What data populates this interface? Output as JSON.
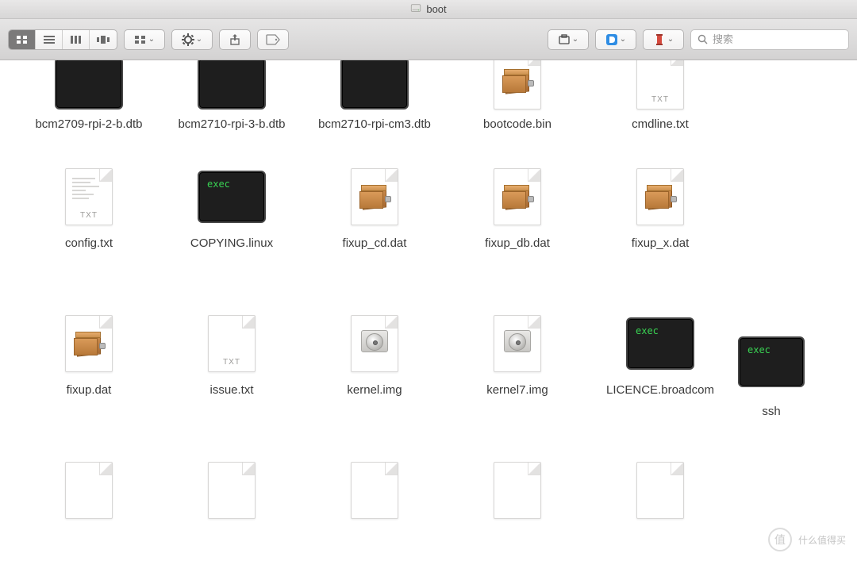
{
  "window": {
    "title": "boot"
  },
  "toolbar": {
    "search_placeholder": "搜索"
  },
  "icons": {
    "exec_label": "exec"
  },
  "files": {
    "row1": [
      {
        "name": "bcm2709-rpi-2-b.dtb",
        "kind": "exec-plain"
      },
      {
        "name": "bcm2710-rpi-3-b.dtb",
        "kind": "exec-plain"
      },
      {
        "name": "bcm2710-rpi-cm3.dtb",
        "kind": "exec-plain"
      },
      {
        "name": "bootcode.bin",
        "kind": "archive"
      },
      {
        "name": "cmdline.txt",
        "kind": "txt"
      }
    ],
    "row2": [
      {
        "name": "config.txt",
        "kind": "txt-scribble"
      },
      {
        "name": "COPYING.linux",
        "kind": "exec"
      },
      {
        "name": "fixup_cd.dat",
        "kind": "archive"
      },
      {
        "name": "fixup_db.dat",
        "kind": "archive"
      },
      {
        "name": "fixup_x.dat",
        "kind": "archive"
      }
    ],
    "row3": [
      {
        "name": "fixup.dat",
        "kind": "archive"
      },
      {
        "name": "issue.txt",
        "kind": "txt"
      },
      {
        "name": "kernel.img",
        "kind": "disk"
      },
      {
        "name": "kernel7.img",
        "kind": "disk"
      },
      {
        "name": "LICENCE.broadcom",
        "kind": "exec"
      }
    ],
    "row4": [
      {
        "name": "",
        "kind": "blank"
      },
      {
        "name": "",
        "kind": "blank"
      },
      {
        "name": "",
        "kind": "blank"
      },
      {
        "name": "",
        "kind": "blank"
      },
      {
        "name": "",
        "kind": "blank"
      }
    ]
  },
  "float_file": {
    "name": "ssh",
    "kind": "exec"
  },
  "watermark": {
    "text": "什么值得买"
  }
}
